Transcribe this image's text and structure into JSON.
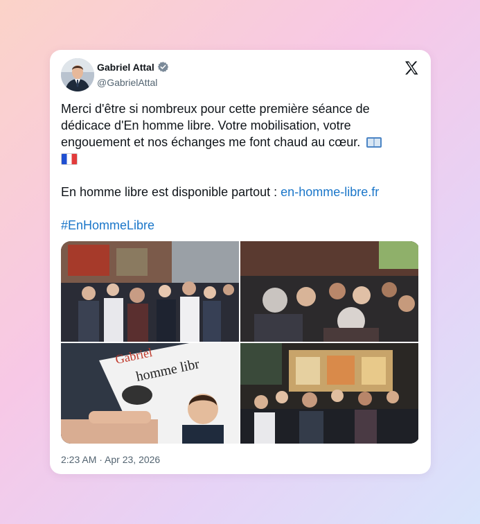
{
  "author": {
    "name": "Gabriel Attal",
    "handle": "@GabrielAttal",
    "verified": true
  },
  "post": {
    "paragraph1": "Merci d'être si nombreux pour cette première séance de dédicace d'En homme libre. Votre mobilisation, votre engouement et nos échanges me font chaud au cœur.",
    "emojis": [
      "book-emoji",
      "flag-france-emoji"
    ],
    "paragraph2_text": "En homme libre est disponible partout : ",
    "paragraph2_link": "en-homme-libre.fr",
    "hashtag": "#EnHommeLibre"
  },
  "media": {
    "photo_count": 4,
    "book_cover_text": [
      "Gabriel",
      "homme libr"
    ]
  },
  "timestamp": {
    "time": "2:23 AM",
    "separator": " · ",
    "date": "Apr 23, 2026"
  },
  "colors": {
    "link": "#1a76c9",
    "text": "#0f1419",
    "muted": "#536471",
    "verified_badge": "#7b8a99"
  },
  "icons": [
    "x-logo-icon",
    "verified-badge-icon"
  ]
}
